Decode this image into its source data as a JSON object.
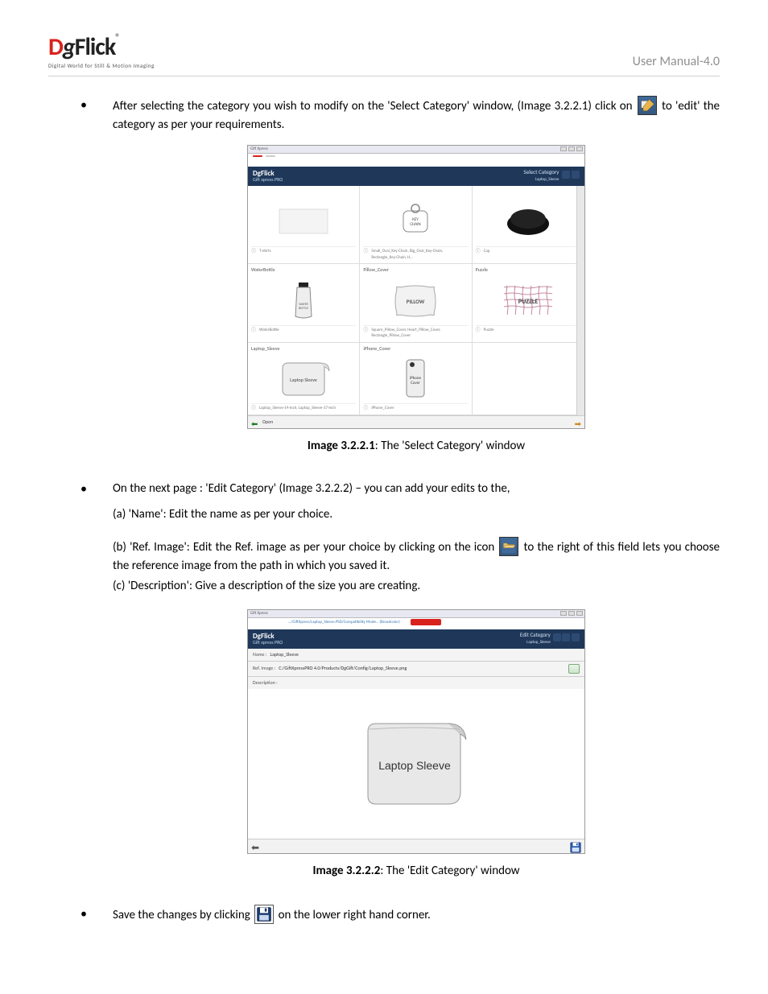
{
  "header": {
    "logo_brand": "DgFlick",
    "logo_tag": "Digital World for Still & Motion Imaging",
    "manual": "User Manual-4.0"
  },
  "body": {
    "bullet1_a": "After selecting the category you wish to modify on the 'Select Category' window, (Image 3.2.2.1) click on ",
    "bullet1_b": " to 'edit' the category as per your requirements.",
    "caption1_b": "Image 3.2.2.1",
    "caption1_r": ": The 'Select Category' window",
    "bullet2": "On the next page : 'Edit Category' (Image 3.2.2.2) – you can add your edits to the,",
    "sub_a": "(a) 'Name': Edit the name as per your choice.",
    "sub_b1": "(b) 'Ref. Image': Edit the Ref. image as per your choice by clicking on the icon ",
    "sub_b2": " to the right of this field lets you choose the reference image from the path in which you saved it.",
    "sub_c": "(c) 'Description': Give a description of the size you are creating.",
    "caption2_b": "Image 3.2.2.2",
    "caption2_r": ": The 'Edit Category' window",
    "bullet3_a": "Save the changes by clicking ",
    "bullet3_b": " on the lower right hand corner."
  },
  "ss1": {
    "win_title": "Gift Xpress",
    "brand": "DgFlick",
    "brand_sub": "Gift xpress PRO",
    "panel_title": "Select Category",
    "panel_sub": "Laptop_Sleeve",
    "cells": [
      {
        "title": "",
        "sub": "T-shirts",
        "kind": "blank"
      },
      {
        "title": "",
        "sub": "Small_Oval_Key-Chain, Big_Oval_Key-Chain, Rectangle_Key-Chain, H…",
        "kind": "keychain",
        "label": "KEY CHAIN"
      },
      {
        "title": "",
        "sub": "Cap",
        "kind": "cap"
      },
      {
        "title": "WaterBottle",
        "sub": "WaterBottle",
        "kind": "bottle",
        "label": "WATER BOTTLE"
      },
      {
        "title": "Pillow_Cover",
        "sub": "Square_Pillow_Cover, Heart_Pillow_Cover, Rectangle_Pillow_Cover",
        "kind": "pillow",
        "label": "PILLOW"
      },
      {
        "title": "Puzzle",
        "sub": "Puzzle",
        "kind": "puzzle",
        "label": "PUZZLE"
      },
      {
        "title": "Laptop_Sleeve",
        "sub": "Laptop_Sleeve-14-Inch, Laptop_Sleeve-17-Inch",
        "kind": "sleeve",
        "label": "Laptop Sleeve"
      },
      {
        "title": "iPhone_Cover",
        "sub": "iPhone_Cover",
        "kind": "iphone",
        "label": "iPhone Cover"
      },
      {
        "title": "",
        "sub": "",
        "kind": "empty"
      }
    ],
    "footer_open": "Open"
  },
  "ss2": {
    "win_title": "Gift Xpress",
    "brand": "DgFlick",
    "brand_sub": "Gift xpress PRO",
    "panel_title": "Edit Category",
    "panel_sub": "Laptop_Sleeve",
    "name_lbl": "Name :",
    "name_val": "Laptop_Sleeve",
    "ref_lbl": "Ref. Image :",
    "ref_val": "C:/GiftXpressPRO 4.0/Products/DgGift/Config/Laptop_Sleeve.png",
    "desc_lbl": "Description :",
    "preview_label": "Laptop Sleeve",
    "crumbs": "…/GiftXpress/Laptop_Sleeve.PSD/Compatibility Mode… (Broadcolor)"
  }
}
